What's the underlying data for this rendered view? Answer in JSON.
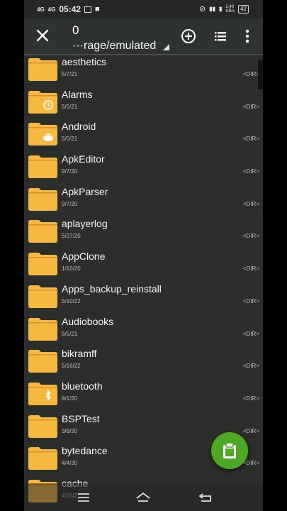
{
  "status_bar": {
    "sig1": "4G",
    "sig2": "4G",
    "time": "05:42",
    "net_speed": "2.40",
    "net_unit": "KB/s",
    "battery": "42"
  },
  "toolbar": {
    "selected_count": "0",
    "path": "···rage/emulated"
  },
  "files": [
    {
      "name": "aesthetics",
      "date": "5/7/21",
      "type": "<DIR>",
      "badge": ""
    },
    {
      "name": "Alarms",
      "date": "5/5/21",
      "type": "<DIR>",
      "badge": "alarm"
    },
    {
      "name": "Android",
      "date": "5/5/21",
      "type": "<DIR>",
      "badge": "android"
    },
    {
      "name": "ApkEditor",
      "date": "9/7/20",
      "type": "<DIR>",
      "badge": ""
    },
    {
      "name": "ApkParser",
      "date": "9/7/20",
      "type": "<DIR>",
      "badge": ""
    },
    {
      "name": "aplayerlog",
      "date": "5/27/20",
      "type": "<DIR>",
      "badge": ""
    },
    {
      "name": "AppClone",
      "date": "1/10/20",
      "type": "<DIR>",
      "badge": ""
    },
    {
      "name": "Apps_backup_reinstall",
      "date": "5/10/22",
      "type": "<DIR>",
      "badge": ""
    },
    {
      "name": "Audiobooks",
      "date": "5/5/21",
      "type": "<DIR>",
      "badge": ""
    },
    {
      "name": "bikramff",
      "date": "5/16/22",
      "type": "<DIR>",
      "badge": ""
    },
    {
      "name": "bluetooth",
      "date": "9/1/20",
      "type": "<DIR>",
      "badge": "bluetooth"
    },
    {
      "name": "BSPTest",
      "date": "3/6/20",
      "type": "<DIR>",
      "badge": ""
    },
    {
      "name": "bytedance",
      "date": "4/4/20",
      "type": "<DIR>",
      "badge": ""
    },
    {
      "name": "cache",
      "date": "4/16/2",
      "type": "",
      "badge": ""
    }
  ],
  "icons": {
    "close": "close-icon",
    "add": "add-circle-icon",
    "view": "list-view-icon",
    "more": "more-vert-icon",
    "fab": "paste-clipboard-icon"
  },
  "colors": {
    "background": "#2b2e2b",
    "folder": "#f5b841",
    "fab": "#4fa824"
  }
}
